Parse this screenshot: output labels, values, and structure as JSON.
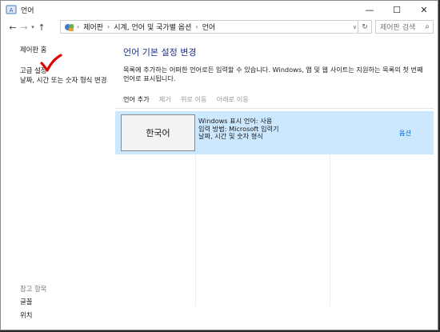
{
  "window": {
    "title": "언어",
    "minimize": "—",
    "maximize": "☐",
    "close": "✕"
  },
  "nav": {
    "back": "←",
    "forward": "→",
    "up": "↑",
    "breadcrumbs": [
      "제어판",
      "시계, 언어 및 국가별 옵션",
      "언어"
    ],
    "search_placeholder": "제어판 검색"
  },
  "left_pane": {
    "home": "제어판 홈",
    "advanced": "고급 설정",
    "datetime": "날짜, 시간 또는 숫자 형식 변경",
    "see_also": "참고 항목",
    "fonts": "글꼴",
    "location": "위치"
  },
  "main": {
    "title": "언어 기본 설정 변경",
    "description": "목록에 추가하는 어떠한 언어로든 입력할 수 있습니다. Windows, 앱 및 웹 사이트는 지원하는 목록의 첫 번째 언어로 표시됩니다.",
    "toolbar": {
      "add": "언어 추가",
      "remove": "제거",
      "move_up": "위로 이동",
      "move_down": "아래로 이동"
    },
    "languages": [
      {
        "name": "한국어",
        "display": "Windows 표시 언어: 사용",
        "input": "입력 방법: Microsoft 입력기",
        "format": "날짜, 시간 및 숫자 형식",
        "options": "옵션"
      }
    ]
  },
  "colors": {
    "accent_title": "#1e3287",
    "selection": "#cce8ff",
    "link": "#0066cc",
    "checkmark": "#e00000"
  },
  "icons": {
    "title": "language-icon",
    "address": "control-panel-icon",
    "search": "search-icon",
    "refresh": "refresh-icon"
  }
}
